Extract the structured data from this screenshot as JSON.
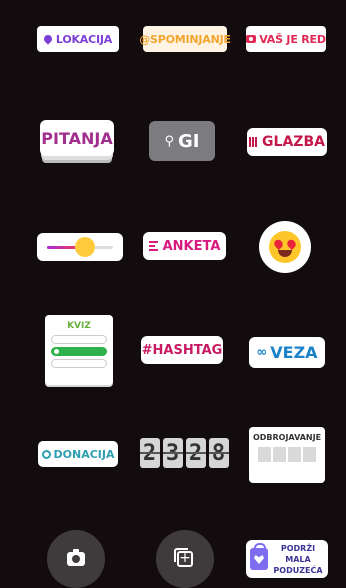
{
  "stickers": {
    "lokacija": "LOKACIJA",
    "spominjanje": "@SPOMINJANJE",
    "vas_je_red": "VAŠ JE RED",
    "pitanja": "PITANJA",
    "gif": "GI",
    "glazba": "GLAZBA",
    "anketa": "ANKETA",
    "kviz": "KVIZ",
    "hashtag": "#HASHTAG",
    "veza": "VEZA",
    "donacija": "DONACIJA",
    "timer_digits": [
      "2",
      "3",
      "2",
      "8"
    ],
    "odbrojavanje": "ODBROJAVANJE",
    "podrzi_line1": "PODRŽI MALA",
    "podrzi_line2": "PODUZEĆA"
  },
  "slider_level": 0.45,
  "icons": [
    "location-pin-icon",
    "camera-icon",
    "music-bars-icon",
    "search-icon",
    "poll-lines-icon",
    "heart-eyes-emoji-icon",
    "link-icon",
    "donation-icon",
    "camera-button-icon",
    "add-media-icon",
    "shopping-bag-icon"
  ],
  "colors": {
    "background": "#120c0e",
    "location": "#7b3fd6",
    "mention": "#f3a52d",
    "music": "#c4184a",
    "poll": "#d8197e",
    "link": "#1a82c8",
    "donation": "#2e9fb2",
    "quiz_selected": "#2eb04a"
  }
}
